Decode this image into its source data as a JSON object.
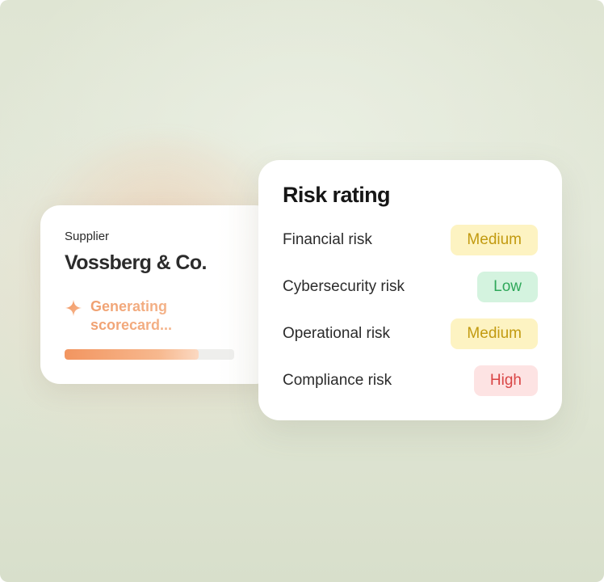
{
  "supplier": {
    "label": "Supplier",
    "name": "Vossberg & Co.",
    "status_text": "Generating scorecard...",
    "progress": 0.79
  },
  "risk_rating": {
    "title": "Risk rating",
    "items": [
      {
        "name": "Financial risk",
        "level": "Medium"
      },
      {
        "name": "Cybersecurity risk",
        "level": "Low"
      },
      {
        "name": "Operational risk",
        "level": "Medium"
      },
      {
        "name": "Compliance risk",
        "level": "High"
      }
    ]
  },
  "colors": {
    "accent_orange": "#f29560",
    "medium_bg": "#fdf3c2",
    "medium_text": "#c29a10",
    "low_bg": "#d4f3df",
    "low_text": "#2fa85a",
    "high_bg": "#fde3e3",
    "high_text": "#d94545"
  },
  "icons": {
    "status": "sparkle-icon"
  }
}
